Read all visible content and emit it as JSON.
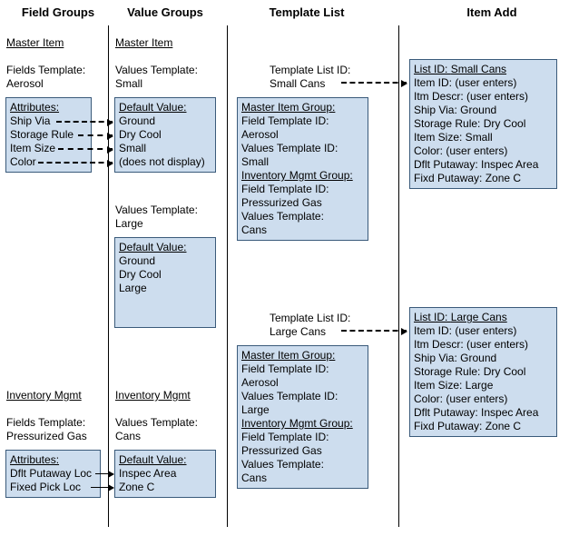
{
  "columns": {
    "c1": "Field Groups",
    "c2": "Value Groups",
    "c3": "Template List",
    "c4": "Item Add"
  },
  "sections": {
    "master_item": "Master Item",
    "inventory_mgmt": "Inventory Mgmt"
  },
  "col1": {
    "fields_template_label": "Fields Template:",
    "fields_template_value_aerosol": "Aerosol",
    "attrs_hdr": "Attributes:",
    "attrs1": [
      "Ship Via",
      "Storage Rule",
      "Item Size",
      "Color"
    ],
    "fields_template_value_pressurized": "Pressurized Gas",
    "attrs2": [
      "Dflt Putaway Loc",
      "Fixed Pick Loc"
    ]
  },
  "col2": {
    "values_template_label": "Values Template:",
    "values_template_small": "Small",
    "default_value_hdr": "Default Value:",
    "vals_small": [
      "Ground",
      "Dry Cool",
      "Small",
      "(does not display)"
    ],
    "values_template_large": "Large",
    "vals_large": [
      "Ground",
      "Dry Cool",
      "Large"
    ],
    "values_template_cans": "Cans",
    "vals_cans": [
      "Inspec Area",
      "Zone C"
    ]
  },
  "col3": {
    "template_list_id_label": "Template List ID:",
    "tl_small_cans": "Small Cans",
    "master_item_group_hdr": "Master Item Group:",
    "field_template_id_label": "Field Template ID:",
    "aerosol": "Aerosol",
    "values_template_id_label": "Values Template ID:",
    "small": "Small",
    "inventory_mgmt_group_hdr": "Inventory Mgmt Group:",
    "pressurized_gas": "Pressurized Gas",
    "values_template_label": "Values Template:",
    "cans": "Cans",
    "tl_large_cans": "Large Cans",
    "large": "Large"
  },
  "col4": {
    "list_id_label": "List ID: ",
    "small_cans": "Small Cans",
    "large_cans": "Large Cans",
    "lines_small": [
      "Item ID: (user enters)",
      "Itm Descr: (user enters)",
      "Ship Via: Ground",
      "Storage Rule: Dry Cool",
      "Item Size: Small",
      "Color: (user enters)",
      "Dflt Putaway: Inspec Area",
      "Fixd Putaway: Zone C"
    ],
    "lines_large": [
      "Item ID: (user enters)",
      "Itm Descr: (user enters)",
      "Ship Via: Ground",
      "Storage Rule: Dry Cool",
      "Item Size: Large",
      "Color: (user enters)",
      "Dflt Putaway: Inspec Area",
      "Fixd Putaway: Zone C"
    ]
  }
}
